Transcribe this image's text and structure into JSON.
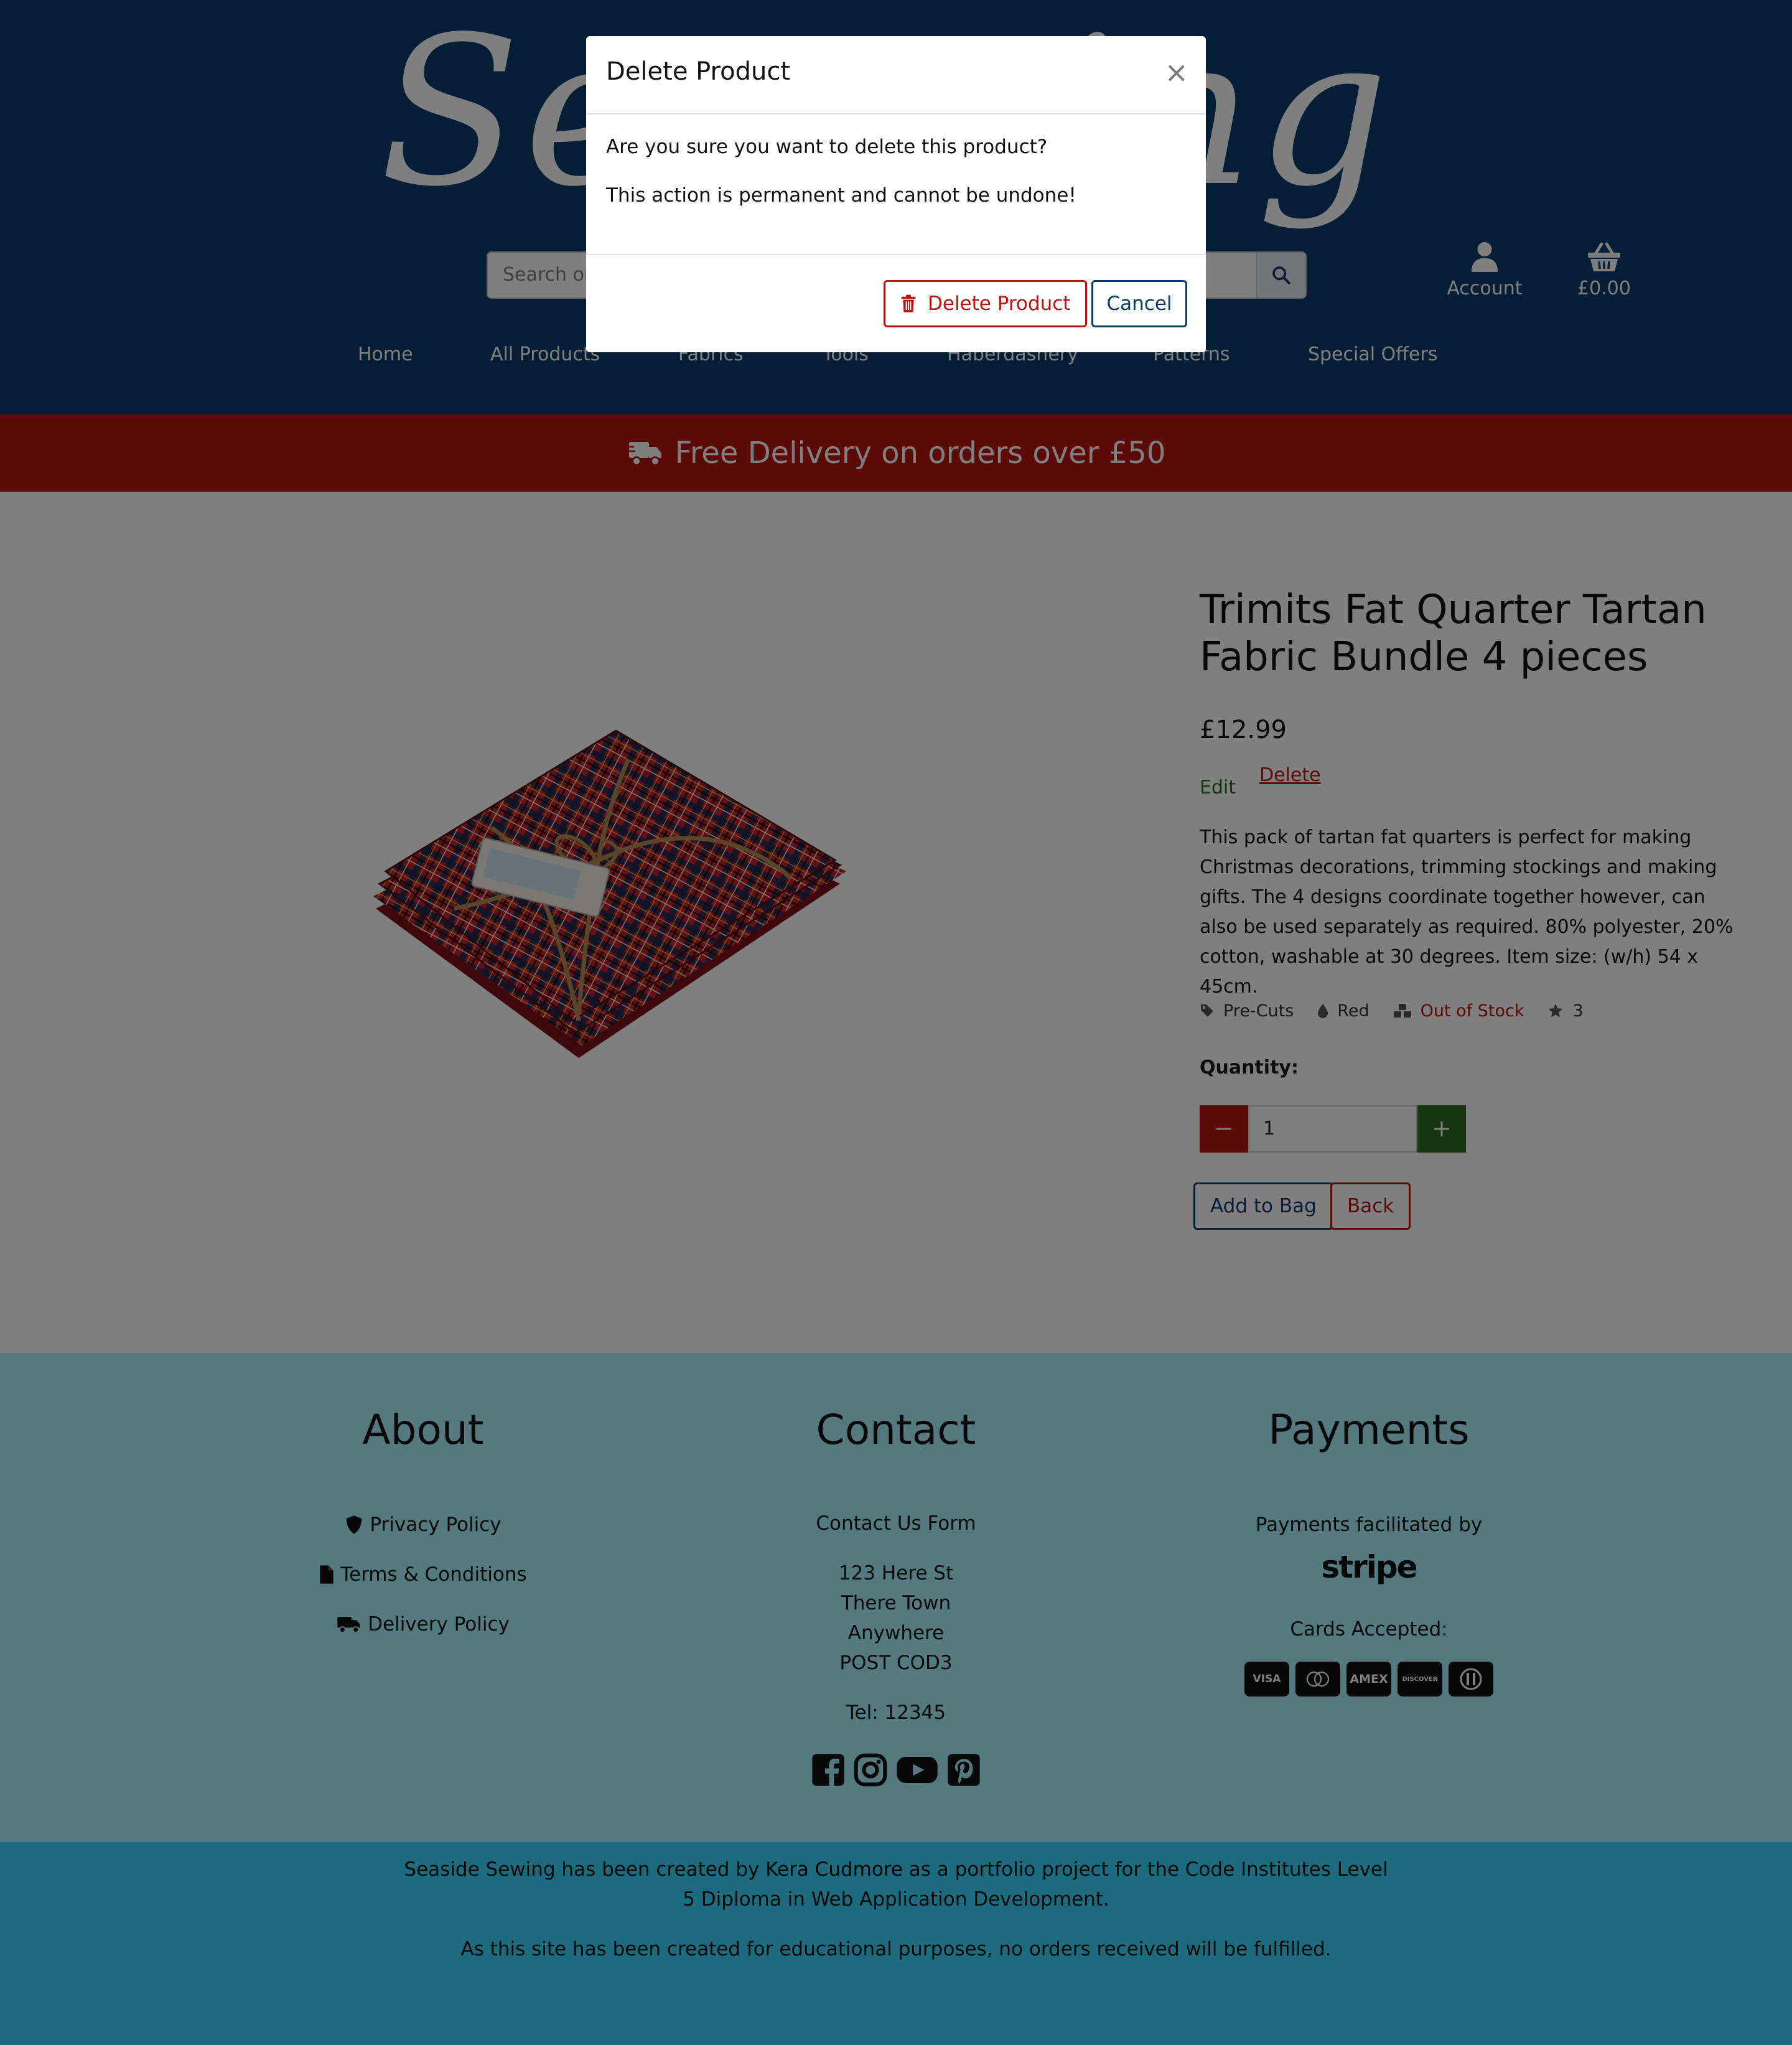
{
  "header": {
    "logo_part1": "Sea",
    "logo_part2": "ing",
    "search_placeholder": "Search ou",
    "account_label": "Account",
    "basket_total": "£0.00",
    "nav": [
      "Home",
      "All Products",
      "Fabrics",
      "Tools",
      "Haberdashery",
      "Patterns",
      "Special Offers"
    ],
    "search_icon": "search-icon",
    "account_icon": "user-icon",
    "basket_icon": "basket-icon"
  },
  "banner": {
    "text": "Free Delivery on orders over £50",
    "icon": "truck-icon"
  },
  "product": {
    "title": "Trimits Fat Quarter Tartan Fabric Bundle 4 pieces",
    "price": "£12.99",
    "edit_label": "Edit",
    "delete_label": "Delete",
    "description": "This pack of tartan fat quarters is perfect for making Christmas decorations, trimming stockings and making gifts. The 4 designs coordinate together however, can also be used separately as required. 80% polyester, 20% cotton, washable at 30 degrees. Item size: (w/h) 54 x 45cm.",
    "category": "Pre-Cuts",
    "colour": "Red",
    "stock_status": "Out of Stock",
    "rating": "3",
    "quantity_label": "Quantity:",
    "quantity_value": "1",
    "add_to_bag_label": "Add to Bag",
    "back_label": "Back"
  },
  "footer": {
    "about_title": "About",
    "about_links": [
      "Privacy Policy",
      "Terms & Conditions",
      "Delivery Policy"
    ],
    "contact_title": "Contact",
    "contact_form_label": "Contact Us Form",
    "address": [
      "123 Here St",
      "There Town",
      "Anywhere",
      "POST COD3"
    ],
    "tel": "Tel: 12345",
    "payments_title": "Payments",
    "payments_by": "Payments facilitated by",
    "stripe": "stripe",
    "cards_label": "Cards Accepted:",
    "cards": [
      "VISA",
      "MC",
      "AMEX",
      "DISCOVER",
      "DINERS"
    ]
  },
  "credits": {
    "line1_a": "Seaside Sewing has been created by ",
    "line1_author": "Kera Cudmore",
    "line1_b": " as a portfolio project for the Code Institutes Level",
    "line2": "5 Diploma in Web Application Development.",
    "line3": "As this site has been created for educational purposes, no orders received will be fulfilled."
  },
  "modal": {
    "title": "Delete Product",
    "close": "×",
    "body1": "Are you sure you want to delete this product?",
    "body2": "This action is permanent and cannot be undone!",
    "delete_button": "Delete Product",
    "cancel_button": "Cancel"
  },
  "colors": {
    "navy": "#0a3a6b",
    "red": "#b8150e",
    "green": "#2e6b1e",
    "footer_bg": "#a8f2ff",
    "credits_bg": "#39d7ff"
  }
}
